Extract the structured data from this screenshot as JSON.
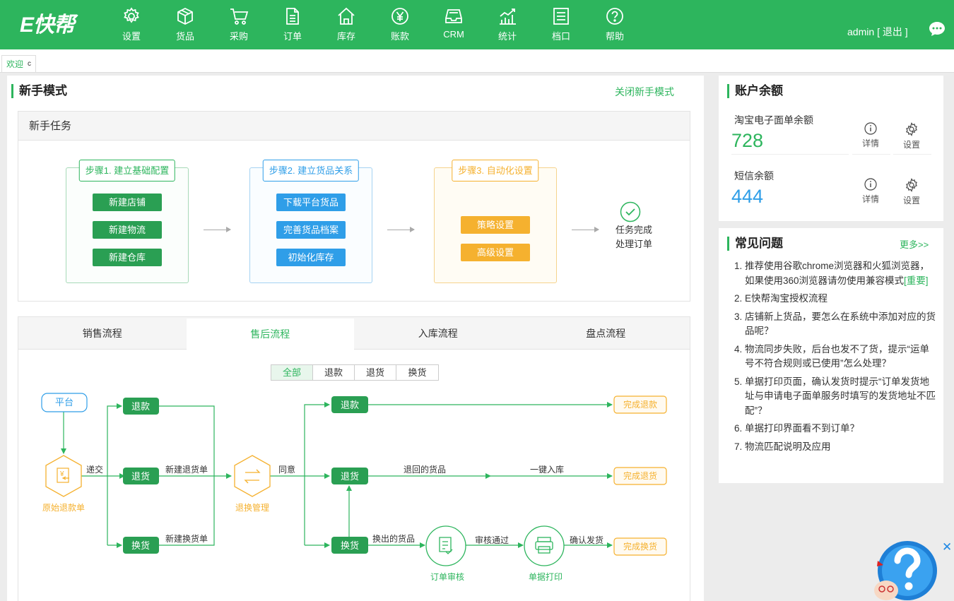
{
  "header": {
    "logo": "E快帮",
    "nav": [
      {
        "label": "设置",
        "icon": "gear-icon"
      },
      {
        "label": "货品",
        "icon": "box-icon"
      },
      {
        "label": "采购",
        "icon": "cart-icon"
      },
      {
        "label": "订单",
        "icon": "document-icon"
      },
      {
        "label": "库存",
        "icon": "home-icon"
      },
      {
        "label": "账款",
        "icon": "yen-icon"
      },
      {
        "label": "CRM",
        "icon": "inbox-icon"
      },
      {
        "label": "统计",
        "icon": "chart-icon"
      },
      {
        "label": "档口",
        "icon": "list-icon"
      },
      {
        "label": "帮助",
        "icon": "help-icon"
      }
    ],
    "user": "admin",
    "logout": "[ 退出 ]"
  },
  "tabs": {
    "welcome": "欢迎",
    "refresh": "c"
  },
  "beginner": {
    "title": "新手模式",
    "close_link": "关闭新手模式",
    "task_title": "新手任务",
    "steps": [
      {
        "title": "步骤1. 建立基础配置",
        "buttons": [
          "新建店铺",
          "新建物流",
          "新建仓库"
        ]
      },
      {
        "title": "步骤2. 建立货品关系",
        "buttons": [
          "下载平台货品",
          "完善货品档案",
          "初始化库存"
        ]
      },
      {
        "title": "步骤3. 自动化设置",
        "buttons": [
          "策略设置",
          "高级设置"
        ]
      }
    ],
    "finish": [
      "任务完成",
      "处理订单"
    ]
  },
  "flow": {
    "tabs": [
      "销售流程",
      "售后流程",
      "入库流程",
      "盘点流程"
    ],
    "active_tab": "售后流程",
    "filters": [
      "全部",
      "退款",
      "退货",
      "换货"
    ],
    "nodes": {
      "platform": "平台",
      "original": "原始退款单",
      "submit": "递交",
      "refund": "退款",
      "return": "退货",
      "exchange": "换货",
      "new_return": "新建退货单",
      "new_exchange": "新建换货单",
      "return_mgmt": "退换管理",
      "agree": "同意",
      "returned_goods": "退回的货品",
      "one_click": "一键入库",
      "exchanged_goods": "换出的货品",
      "audit_pass": "审核通过",
      "confirm_ship": "确认发货",
      "order_audit": "订单审核",
      "print": "单据打印",
      "done_refund": "完成退款",
      "done_return": "完成退货",
      "done_exchange": "完成换货"
    }
  },
  "balance": {
    "title": "账户余额",
    "items": [
      {
        "label": "淘宝电子面单余额",
        "value": "728",
        "color": "#2db55d"
      },
      {
        "label": "短信余额",
        "value": "444",
        "color": "#2f9ee8"
      }
    ],
    "detail": "详情",
    "settings": "设置"
  },
  "faq": {
    "title": "常见问题",
    "more": "更多>>",
    "items": [
      {
        "num": "1.",
        "text": "推荐使用谷歌chrome浏览器和火狐浏览器，如果使用360浏览器请勿使用兼容模式",
        "tag": "[重要]"
      },
      {
        "num": "2.",
        "text": "E快帮淘宝授权流程"
      },
      {
        "num": "3.",
        "text": "店铺新上货品，要怎么在系统中添加对应的货品呢？"
      },
      {
        "num": "4.",
        "text": "物流同步失败，后台也发不了货，提示“运单号不符合规则或已使用”怎么处理？"
      },
      {
        "num": "5.",
        "text": "单据打印页面，确认发货时提示“订单发货地址与申请电子面单服务时填写的发货地址不匹配”？"
      },
      {
        "num": "6.",
        "text": "单据打印界面看不到订单？"
      },
      {
        "num": "7.",
        "text": "物流匹配说明及应用"
      }
    ]
  },
  "colors": {
    "brand": "#2db55d",
    "blue": "#2f9ee8",
    "orange": "#f5b12f"
  }
}
